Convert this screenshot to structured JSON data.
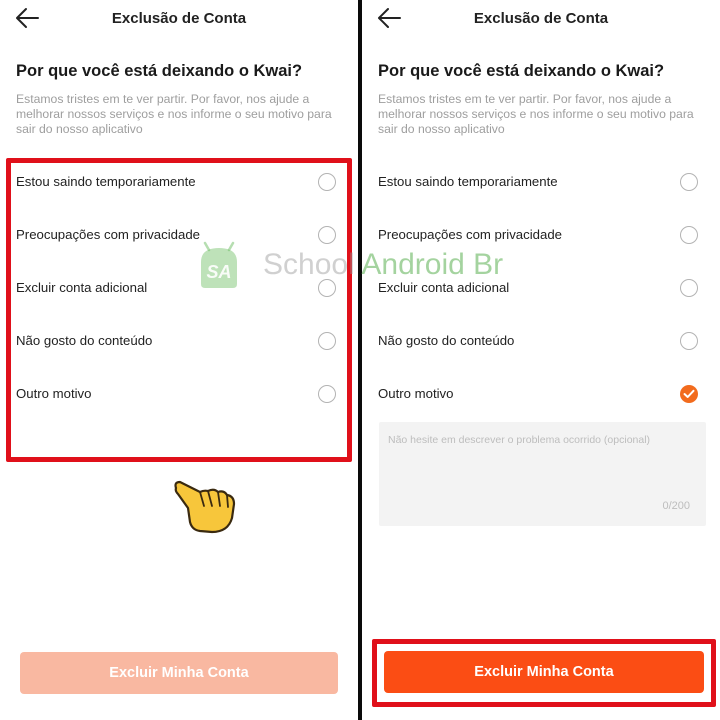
{
  "header": {
    "title": "Exclusão de Conta"
  },
  "heading": "Por que você está deixando o Kwai?",
  "description": "Estamos tristes em te ver partir. Por favor, nos ajude a melhorar nossos serviços e nos informe o seu motivo para sair do nosso aplicativo",
  "options": [
    {
      "label": "Estou saindo temporariamente"
    },
    {
      "label": "Preocupações com privacidade"
    },
    {
      "label": "Excluir conta adicional"
    },
    {
      "label": "Não gosto do conteúdo"
    },
    {
      "label": "Outro motivo"
    }
  ],
  "left_state": {
    "selected": null
  },
  "right_state": {
    "selected": "Outro motivo"
  },
  "textarea": {
    "placeholder": "Não hesite em descrever o problema ocorrido (opcional)",
    "counter": "0/200"
  },
  "button": {
    "label": "Excluir Minha Conta"
  },
  "watermark": {
    "part1": "School",
    "part2": " Android Br",
    "logo_text": "SA"
  },
  "colors": {
    "accent": "#fb4d14",
    "disabled": "#f9b8a1",
    "highlight": "#e0101a",
    "check": "#f26b1d"
  },
  "icons": {
    "back": "arrow-left-icon",
    "hand_left": "pointing-hand-emoji",
    "hand_right": "pointing-hand-emoji"
  }
}
